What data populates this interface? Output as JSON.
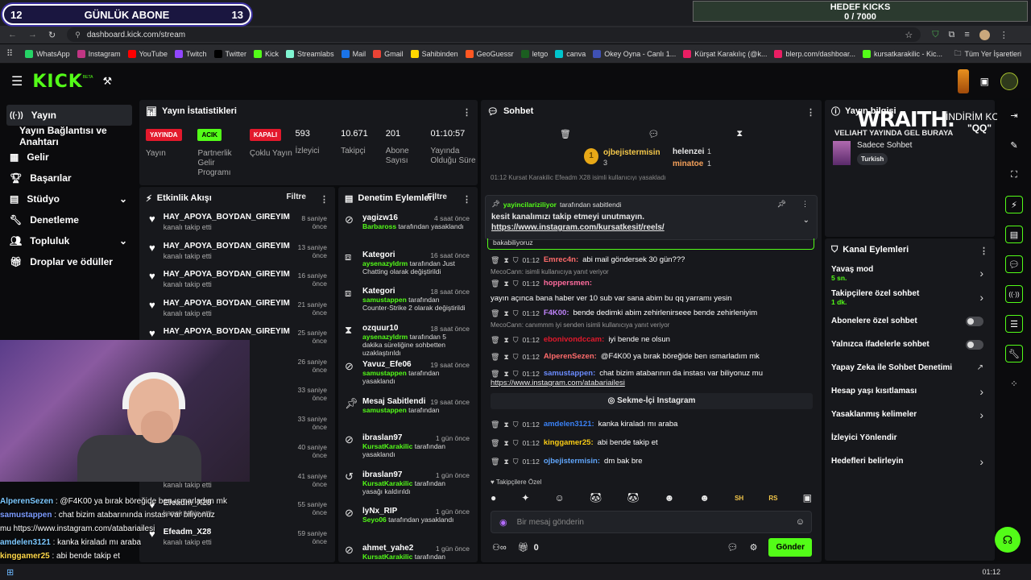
{
  "overlay": {
    "abone_left": "12",
    "abone_title": "GÜNLÜK ABONE",
    "abone_right": "13",
    "kicks_title": "HEDEF KICKS",
    "kicks_value": "0 / 7000"
  },
  "browser": {
    "url": "dashboard.kick.com/stream",
    "bookmarks": [
      "WhatsApp",
      "Instagram",
      "YouTube",
      "Twitch",
      "Twitter",
      "Kick",
      "Streamlabs",
      "Mail",
      "Gmail",
      "Sahibinden",
      "GeoGuessr",
      "letgo",
      "canva",
      "Okey Oyna - Canlı 1...",
      "Kürşat Karakılıç (@k...",
      "blerp.com/dashboar...",
      "kursatkarakilic - Kic..."
    ],
    "all_bookmarks": "Tüm Yer İşaretleri",
    "bookmark_colors": [
      "#25d366",
      "#c13584",
      "#ff0000",
      "#9146ff",
      "#000000",
      "#53fc18",
      "#80f5d2",
      "#1a73e8",
      "#ea4335",
      "#ffd700",
      "#ff5722",
      "#1b5e20",
      "#00c4cc",
      "#3f51b5",
      "#e91e63",
      "#e91e63",
      "#53fc18"
    ]
  },
  "header": {
    "logo": "KICK",
    "beta": "BETA"
  },
  "sidebar": {
    "items": [
      "Yayın",
      "Yayın Bağlantısı ve Anahtarı",
      "Gelir",
      "Başarılar",
      "Stüdyo",
      "Denetleme",
      "Topluluk",
      "Droplar ve ödüller"
    ]
  },
  "stats": {
    "title": "Yayın İstatistikleri",
    "items": [
      {
        "badge": "YAYINDA",
        "badge_color": "#e3192c",
        "label": "Yayın"
      },
      {
        "badge": "ACIK",
        "badge_color": "#53fc18",
        "label": "Partnerlik Gelir Programı"
      },
      {
        "badge": "KAPALI",
        "badge_color": "#e3192c",
        "label": "Çoklu Yayın"
      },
      {
        "value": "593",
        "label": "İzleyici"
      },
      {
        "value": "10.671",
        "label": "Takipçi"
      },
      {
        "value": "201",
        "label": "Abone Sayısı"
      },
      {
        "value": "01:10:57",
        "label": "Yayında Olduğu Süre"
      }
    ]
  },
  "events": {
    "title": "Etkinlik Akışı",
    "filter": "Filtre",
    "rows": [
      {
        "name": "HAY_APOYA_BOYDAN_GIREYIM",
        "sub": "kanalı takip etti",
        "time": "8 saniye önce"
      },
      {
        "name": "HAY_APOYA_BOYDAN_GIREYIM",
        "sub": "kanalı takip etti",
        "time": "13 saniye önce"
      },
      {
        "name": "HAY_APOYA_BOYDAN_GIREYIM",
        "sub": "kanalı takip etti",
        "time": "16 saniye önce"
      },
      {
        "name": "HAY_APOYA_BOYDAN_GIREYIM",
        "sub": "kanalı takip etti",
        "time": "21 saniye önce"
      },
      {
        "name": "HAY_APOYA_BOYDAN_GIREYIM",
        "sub": "",
        "time": "25 saniye önce"
      },
      {
        "name": "",
        "sub": "",
        "time": "26 saniye önce"
      },
      {
        "name": "",
        "sub": "",
        "time": "33 saniye önce"
      },
      {
        "name": "",
        "sub": "",
        "time": "33 saniye önce"
      },
      {
        "name": "",
        "sub": "",
        "time": "40 saniye önce"
      },
      {
        "name": "qrdq29",
        "sub": "kanalı takip etti",
        "time": "41 saniye önce"
      },
      {
        "name": "Efeadm_X28",
        "sub": "kanalı takip etti",
        "time": "55 saniye önce"
      },
      {
        "name": "Efeadm_X28",
        "sub": "kanalı takip etti",
        "time": "59 saniye önce"
      }
    ]
  },
  "mod": {
    "title": "Denetim Eylemleri",
    "filter": "Filtre",
    "rows": [
      {
        "icon": "ban",
        "name": "yagizw16",
        "time": "4 saat önce",
        "who": "Barbaross",
        "rest": " tarafından yasaklandı"
      },
      {
        "icon": "category",
        "name": "Kategori",
        "time": "16 saat önce",
        "who": "aysenazyldrm",
        "rest": " tarafından Just Chatting olarak değiştirildi"
      },
      {
        "icon": "category",
        "name": "Kategori",
        "time": "18 saat önce",
        "who": "samustappen",
        "rest": " tarafından Counter-Strike 2 olarak değiştirildi"
      },
      {
        "icon": "timeout",
        "name": "ozquur10",
        "time": "18 saat önce",
        "who": "aysenazyldrm",
        "rest": " tarafından 5 dakika süreliğine sohbetten uzaklaştırıldı"
      },
      {
        "icon": "ban",
        "name": "Yavuz_Efe06",
        "time": "19 saat önce",
        "who": "samustappen",
        "rest": " tarafından yasaklandı"
      },
      {
        "icon": "pin",
        "name": "Mesaj Sabitlendi",
        "time": "19 saat önce",
        "who": "samustappen",
        "rest": " tarafından"
      },
      {
        "icon": "ban",
        "name": "ibraslan97",
        "time": "1 gün önce",
        "who": "KursatKarakilic",
        "rest": " tarafından yasaklandı"
      },
      {
        "icon": "unban",
        "name": "ibraslan97",
        "time": "1 gün önce",
        "who": "KursatKarakilic",
        "rest": " tarafından yasağı kaldırıldı"
      },
      {
        "icon": "ban",
        "name": "lyNx_RIP",
        "time": "1 gün önce",
        "who": "Seyo06",
        "rest": " tarafından yasaklandı"
      },
      {
        "icon": "ban",
        "name": "ahmet_yahe2",
        "time": "1 gün önce",
        "who": "KursatKarakilic",
        "rest": " tarafından yasaklandı"
      }
    ]
  },
  "chat": {
    "title": "Sohbet",
    "top_gifter": "ojbejistermisin",
    "top_gifter_count": "3",
    "gifters": [
      {
        "name": "helenzei",
        "count": "1"
      },
      {
        "name": "minatoe",
        "count": "1"
      }
    ],
    "pinned_by": "yayincilariziliyor",
    "pinned_rest": " tarafından sabitlendi",
    "pinned_text": "kesit kanalımızı takip etmeyi unutmayın.",
    "pinned_link": "https://www.instagram.com/kursatkesit/reels/",
    "cut_line": "01:12 Kursat Karakilic Efeadm X28 isimli kullanıcıyı yasakladı",
    "partial": "bakabiliyoruz",
    "lines": [
      {
        "reply": "",
        "time": "01:12",
        "user": "Emrec4n",
        "ucolor": "#ff6b6b",
        "text": "abi mail göndersek 30 gün???"
      },
      {
        "reply": "MecoCann: isimli kullanıcıya yanıt veriyor",
        "time": "01:12",
        "user": "hoppersmen",
        "ucolor": "#ff6b9d",
        "text": "yayın açınca bana haber ver 10 sub var sana abim bu qq yarramı yesin"
      },
      {
        "reply": "",
        "time": "01:12",
        "user": "F4K00",
        "ucolor": "#c084fc",
        "text": "bende dedimki abim zehirlenirseee bende zehirleniyim"
      },
      {
        "reply": "MecoCann: canımmm iyi senden isimli kullanıcıya yanıt veriyor",
        "time": "01:12",
        "user": "ebonivondccam",
        "ucolor": "#e3192c",
        "text": "iyi bende ne olsun"
      },
      {
        "reply": "",
        "time": "01:12",
        "user": "AlperenSezen",
        "ucolor": "#ff6b6b",
        "text": "@F4K00 ya bırak böreğide ben ısmarladım mk"
      },
      {
        "reply": "",
        "time": "01:12",
        "user": "samustappen",
        "ucolor": "#6b8cff",
        "text": "chat bizim atabarının da instası var biliyonuz mu"
      }
    ],
    "link_line": "https://www.instagram.com/atabariailesi",
    "insta_card": "Sekme-İçi Instagram",
    "lines2": [
      {
        "time": "01:12",
        "user": "amdelen3121",
        "ucolor": "#3b82f6",
        "text": "kanka kiraladı mı araba"
      },
      {
        "time": "01:12",
        "user": "kinggamer25",
        "ucolor": "#facc15",
        "text": "abi bende takip et"
      },
      {
        "time": "01:12",
        "user": "ojbejistermisin",
        "ucolor": "#60a5fa",
        "text": "dm bak bre"
      }
    ],
    "followers_only": "Takipçilere Özel",
    "input_placeholder": "Bir mesaj gönderin",
    "send": "Gönder",
    "count": "0",
    "emotes": [
      "SH",
      "RS"
    ]
  },
  "info": {
    "title": "Yayın bilgisi",
    "stream_title": "VELIAHT YAYINDA GEL BURAYA",
    "category": "Sadece Sohbet",
    "tag": "Turkish",
    "wraith": "WRAITH.",
    "discount": "İNDİRİM KODU:",
    "code": "\"QQ\""
  },
  "channel": {
    "title": "Kanal Eylemleri",
    "rows": [
      {
        "label": "Yavaş mod",
        "sub": "5 sn.",
        "ctrl": "chev"
      },
      {
        "label": "Takipçilere özel sohbet",
        "sub": "1 dk.",
        "ctrl": "chev"
      },
      {
        "label": "Abonelere özel sohbet",
        "sub": "",
        "ctrl": "toggle"
      },
      {
        "label": "Yalnızca ifadelerle sohbet",
        "sub": "",
        "ctrl": "toggle"
      },
      {
        "label": "Yapay Zeka ile Sohbet Denetimi",
        "sub": "",
        "ctrl": "ext"
      },
      {
        "label": "Hesap yaşı kısıtlaması",
        "sub": "",
        "ctrl": "chev"
      },
      {
        "label": "Yasaklanmış kelimeler",
        "sub": "",
        "ctrl": "chev"
      },
      {
        "label": "İzleyici Yönlendir",
        "sub": "",
        "ctrl": "none"
      },
      {
        "label": "Hedefleri belirleyin",
        "sub": "",
        "ctrl": "chev"
      }
    ]
  },
  "overlay_chat": [
    {
      "user": "AlperenSezen",
      "ucolor": "#7cc8ff",
      "text": " : @F4K00 ya bırak böreğide ben ısmarladım mk"
    },
    {
      "user": "samustappen",
      "ucolor": "#7c9cff",
      "text": " : chat bizim atabarınında instası var biliyonuz"
    },
    {
      "user": "",
      "ucolor": "#fff",
      "text": "mu https://www.instagram.com/atabariailesi"
    },
    {
      "user": "amdelen3121",
      "ucolor": "#7cc8ff",
      "text": " : kanka kiraladı mı araba"
    },
    {
      "user": "kinggamer25",
      "ucolor": "#ffd84a",
      "text": " : abi bende takip et"
    },
    {
      "user": "ojbejistermisin",
      "ucolor": "#7cc8ff",
      "text": " : dm bak bre"
    }
  ],
  "taskbar": {
    "time": "01:12"
  }
}
